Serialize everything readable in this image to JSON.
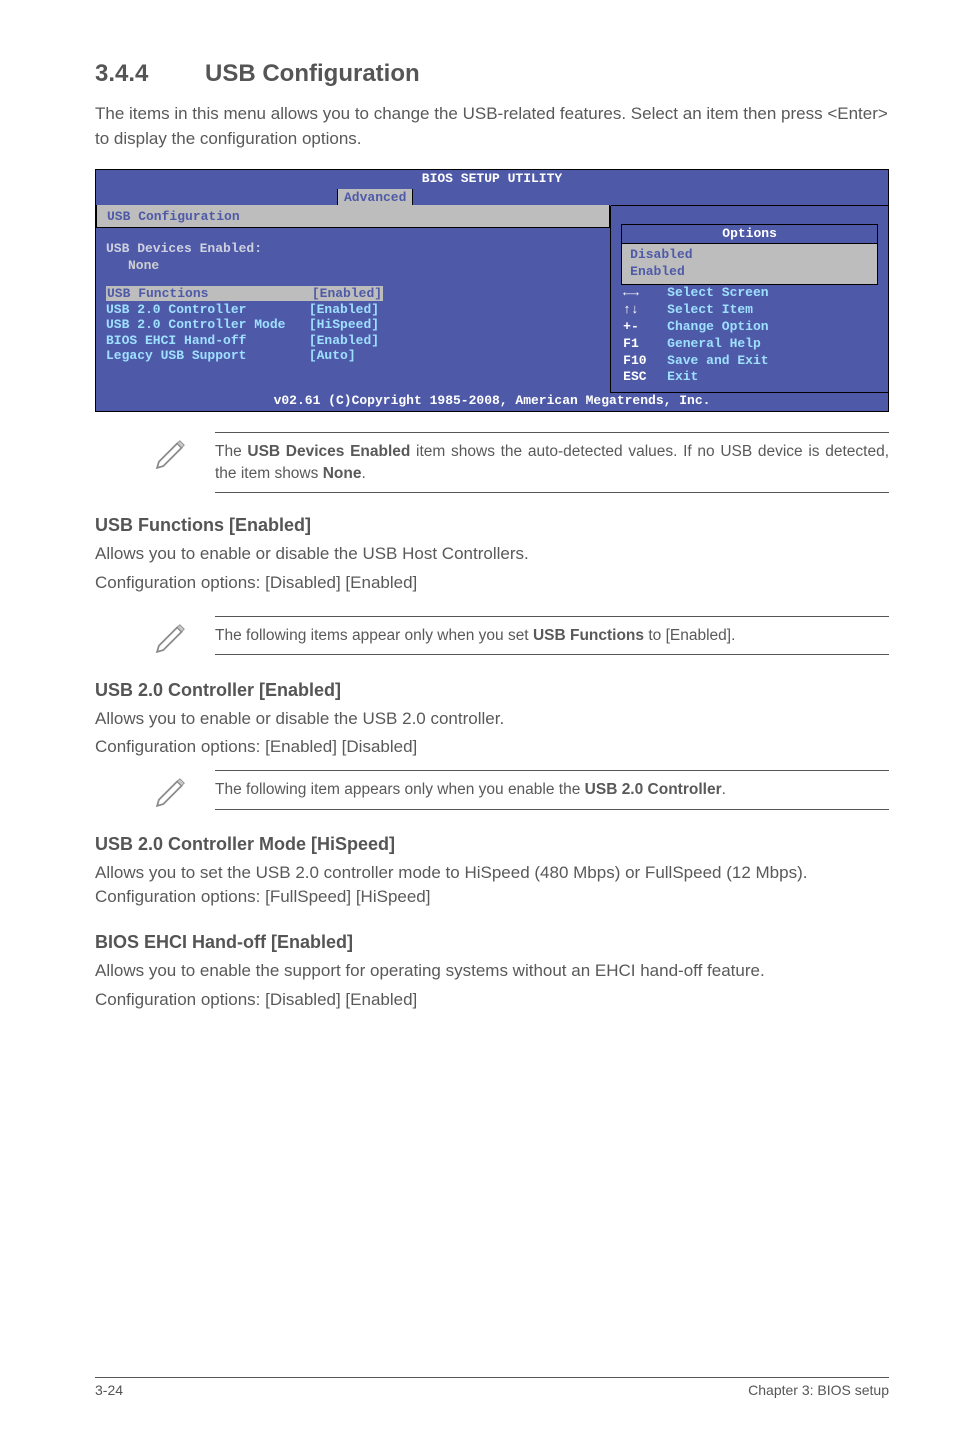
{
  "section": {
    "number": "3.4.4",
    "title": "USB Configuration",
    "intro": "The items in this menu allows you to change the USB-related features. Select an item then press <Enter> to display the configuration options."
  },
  "bios": {
    "window_title": "BIOS SETUP UTILITY",
    "tab": "Advanced",
    "subtitle": "USB Configuration",
    "devices_label": "USB Devices Enabled:",
    "devices_value": "None",
    "rows": [
      {
        "label": "USB Functions",
        "value": "[Enabled]",
        "hl": true
      },
      {
        "label": "USB 2.0 Controller",
        "value": "[Enabled]",
        "hl": false
      },
      {
        "label": "USB 2.0 Controller Mode",
        "value": "[HiSpeed]",
        "hl": false
      },
      {
        "label": "BIOS EHCI Hand-off",
        "value": "[Enabled]",
        "hl": false
      },
      {
        "label": "Legacy USB Support",
        "value": "[Auto]",
        "hl": false
      }
    ],
    "options_title": "Options",
    "options": [
      "Disabled",
      "Enabled"
    ],
    "keys": [
      {
        "k": "←→",
        "t": "Select Screen"
      },
      {
        "k": "↑↓",
        "t": "Select Item"
      },
      {
        "k": "+-",
        "t": " Change Option"
      },
      {
        "k": "F1",
        "t": "General Help"
      },
      {
        "k": "F10",
        "t": "Save and Exit"
      },
      {
        "k": "ESC",
        "t": "Exit"
      }
    ],
    "copyright": "v02.61 (C)Copyright 1985-2008, American Megatrends, Inc."
  },
  "notes": {
    "n1": "The USB Devices Enabled item shows the auto-detected values. If no USB device is detected, the item shows None.",
    "n2": "The following items appear only when you set USB Functions to [Enabled].",
    "n3": "The following item appears only when you enable the USB 2.0 Controller."
  },
  "subs": {
    "s1": {
      "h": "USB Functions [Enabled]",
      "p1": "Allows you to enable or disable the USB Host Controllers.",
      "p2": "Configuration options: [Disabled] [Enabled]"
    },
    "s2": {
      "h": "USB 2.0 Controller [Enabled]",
      "p1": "Allows you to enable or disable the USB 2.0 controller.",
      "p2": "Configuration options: [Enabled] [Disabled]"
    },
    "s3": {
      "h": "USB 2.0 Controller Mode [HiSpeed]",
      "p1": "Allows you to set the USB 2.0 controller mode to HiSpeed (480 Mbps) or FullSpeed (12 Mbps). Configuration options: [FullSpeed] [HiSpeed]"
    },
    "s4": {
      "h": "BIOS EHCI Hand-off [Enabled]",
      "p1": "Allows you to enable the support for operating systems without an EHCI hand-off feature.",
      "p2": "Configuration options: [Disabled] [Enabled]"
    }
  },
  "footer": {
    "left": "3-24",
    "right": "Chapter 3: BIOS setup"
  }
}
